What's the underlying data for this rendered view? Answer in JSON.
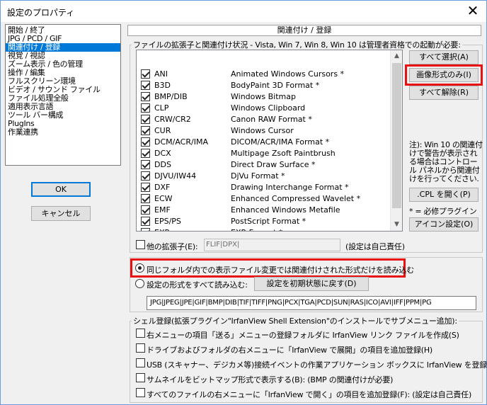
{
  "window": {
    "title": "設定のプロパティ",
    "close_glyph": "✕"
  },
  "categories": [
    "開始 / 終了",
    "JPG / PCD / GIF",
    "関連付け / 登録",
    "視覚 / 視認",
    "ズーム表示 / 色の管理",
    "操作 / 編集",
    "フルスクリーン環境",
    "ビデオ / サウンド ファイル",
    "ファイル処理全般",
    "適用表示言語",
    "ツール バー構成",
    "PlugIns",
    "作業連携"
  ],
  "selected_category": "関連付け / 登録",
  "dialog_buttons": {
    "ok": "OK",
    "cancel": "キャンセル"
  },
  "section_title": "関連付け / 登録",
  "assoc_group_label": "ファイルの拡張子と関連付け状況 - Vista, Win 7, Win 8, Win 10 は管理者資格での起動が必要:",
  "extensions": [
    {
      "ext": "ANI",
      "desc": "Animated Windows Cursors *",
      "checked": true
    },
    {
      "ext": "B3D",
      "desc": "BodyPaint 3D Format *",
      "checked": true
    },
    {
      "ext": "BMP/DIB",
      "desc": "Windows Bitmap",
      "checked": true
    },
    {
      "ext": "CLP",
      "desc": "Windows Clipboard",
      "checked": true
    },
    {
      "ext": "CRW/CR2",
      "desc": "Canon RAW Format *",
      "checked": true
    },
    {
      "ext": "CUR",
      "desc": "Windows Cursor",
      "checked": true
    },
    {
      "ext": "DCM/ACR/IMA",
      "desc": "DICOM/ACR/IMA Format *",
      "checked": true
    },
    {
      "ext": "DCX",
      "desc": "Multipage Zsoft Paintbrush",
      "checked": true
    },
    {
      "ext": "DDS",
      "desc": "Direct Draw Surface *",
      "checked": true
    },
    {
      "ext": "DJVU/IW44",
      "desc": "DjVu Format *",
      "checked": true
    },
    {
      "ext": "DXF",
      "desc": "Drawing Interchange Format *",
      "checked": true
    },
    {
      "ext": "ECW",
      "desc": "Enhanced Compressed Wavelet *",
      "checked": true
    },
    {
      "ext": "EMF",
      "desc": "Enhanced Windows Metafile",
      "checked": true
    },
    {
      "ext": "EPS/PS",
      "desc": "PostScript Format *",
      "checked": true
    },
    {
      "ext": "EXR",
      "desc": "EXR Format *",
      "checked": true
    }
  ],
  "side_buttons": {
    "select_all": "すべて選択(A)",
    "images_only": "画像形式のみ(I)",
    "deselect_all": "すべて解除(R)",
    "open_cpl": ".CPL を開く(P)",
    "icon_settings": "アイコン設定(O)"
  },
  "note_text": "注): Win 10 の関連付けで警告が表示される場合はコントロール パネルから関連付けを行ってください.",
  "required_plugin_note": "* = 必修プラグイン",
  "other_ext": {
    "label": "他の拡張子(E):",
    "value": "FLIF|DPX|",
    "hint": "(設定は自己責任)"
  },
  "radio_same_folder": {
    "label": "同じフォルダ内での表示ファイル変更では関連付けされた形式だけを読み込む",
    "selected": true
  },
  "radio_all_formats": {
    "label": "設定の形式をすべて読み込む:",
    "selected": false
  },
  "reset_button": "設定を初期状態に戻す(D)",
  "format_list": "JPG|JPEG|JPE|GIF|BMP|DIB|TIF|TIFF|PNG|PCX|TGA|PCD|SUN|RAS|ICO|AVI|IFF|PPM|PG",
  "shell_group_label": "シェル登録(拡張プラグイン\"IrfanView Shell Extension\"のインストールでサブメニュー追加):",
  "shell_options": [
    "右メニューの項目「送る」メニューの登録フォルダに IrfanView リンク ファイルを作成(S)",
    "ドライブおよびフォルダの右メニューに「IrfanView で展開」の項目を追加登録(H)",
    "USB (スキャナー、デジカメ等)接続イベントの作業アプリケーション ボックスに IrfanView を登録(U)",
    "サムネイルをビットマップ形式で表示する(B):  (BMP の関連付けが必要)",
    "すべてのファイルの右メニューに「IrfanView で開く」の項目を追加登録(F):  (設定は自己責任)"
  ]
}
